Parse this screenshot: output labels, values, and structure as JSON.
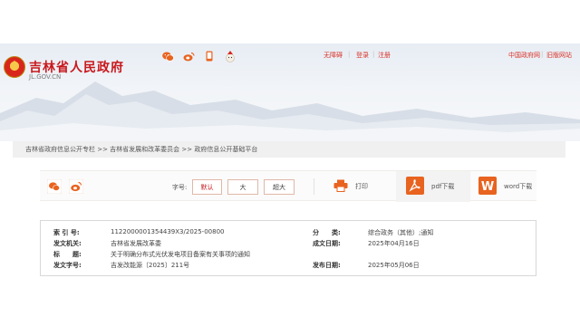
{
  "site": {
    "title": "吉林省人民政府",
    "domain": "JL.GOV.CN"
  },
  "top_links": {
    "accessibility": "无障碍",
    "login": "登录",
    "register": "注册",
    "china_gov": "中国政府网",
    "old_version": "旧版网站"
  },
  "breadcrumb": "吉林省政府信息公开专栏 >> 吉林省发展和改革委员会 >> 政府信息公开基础平台",
  "toolbar": {
    "font_label": "字号:",
    "default": "默认",
    "large": "大",
    "xlarge": "超大",
    "print": "打印",
    "pdf": "pdf下载",
    "word": "word下载"
  },
  "info": {
    "index_label": "索 引 号:",
    "index_value": "112200000135443​9X3/2025-00800",
    "category_label": "分　　类:",
    "category_value": "综合政务（其他）;通知",
    "issuer_label": "发文机关:",
    "issuer_value": "吉林省发展改革委",
    "date_label": "成文日期:",
    "date_value": "2025年04月16日",
    "title_label": "标　　题:",
    "title_value": "关于明确分布式光伏发电项目备案有关事项的通知",
    "docno_label": "发文字号:",
    "docno_value": "吉发改能源〔2025〕211号",
    "publish_label": "发布日期:",
    "publish_value": "2025年05月06日"
  },
  "colors": {
    "brand_red": "#c8191d",
    "accent_orange": "#e8631f"
  }
}
